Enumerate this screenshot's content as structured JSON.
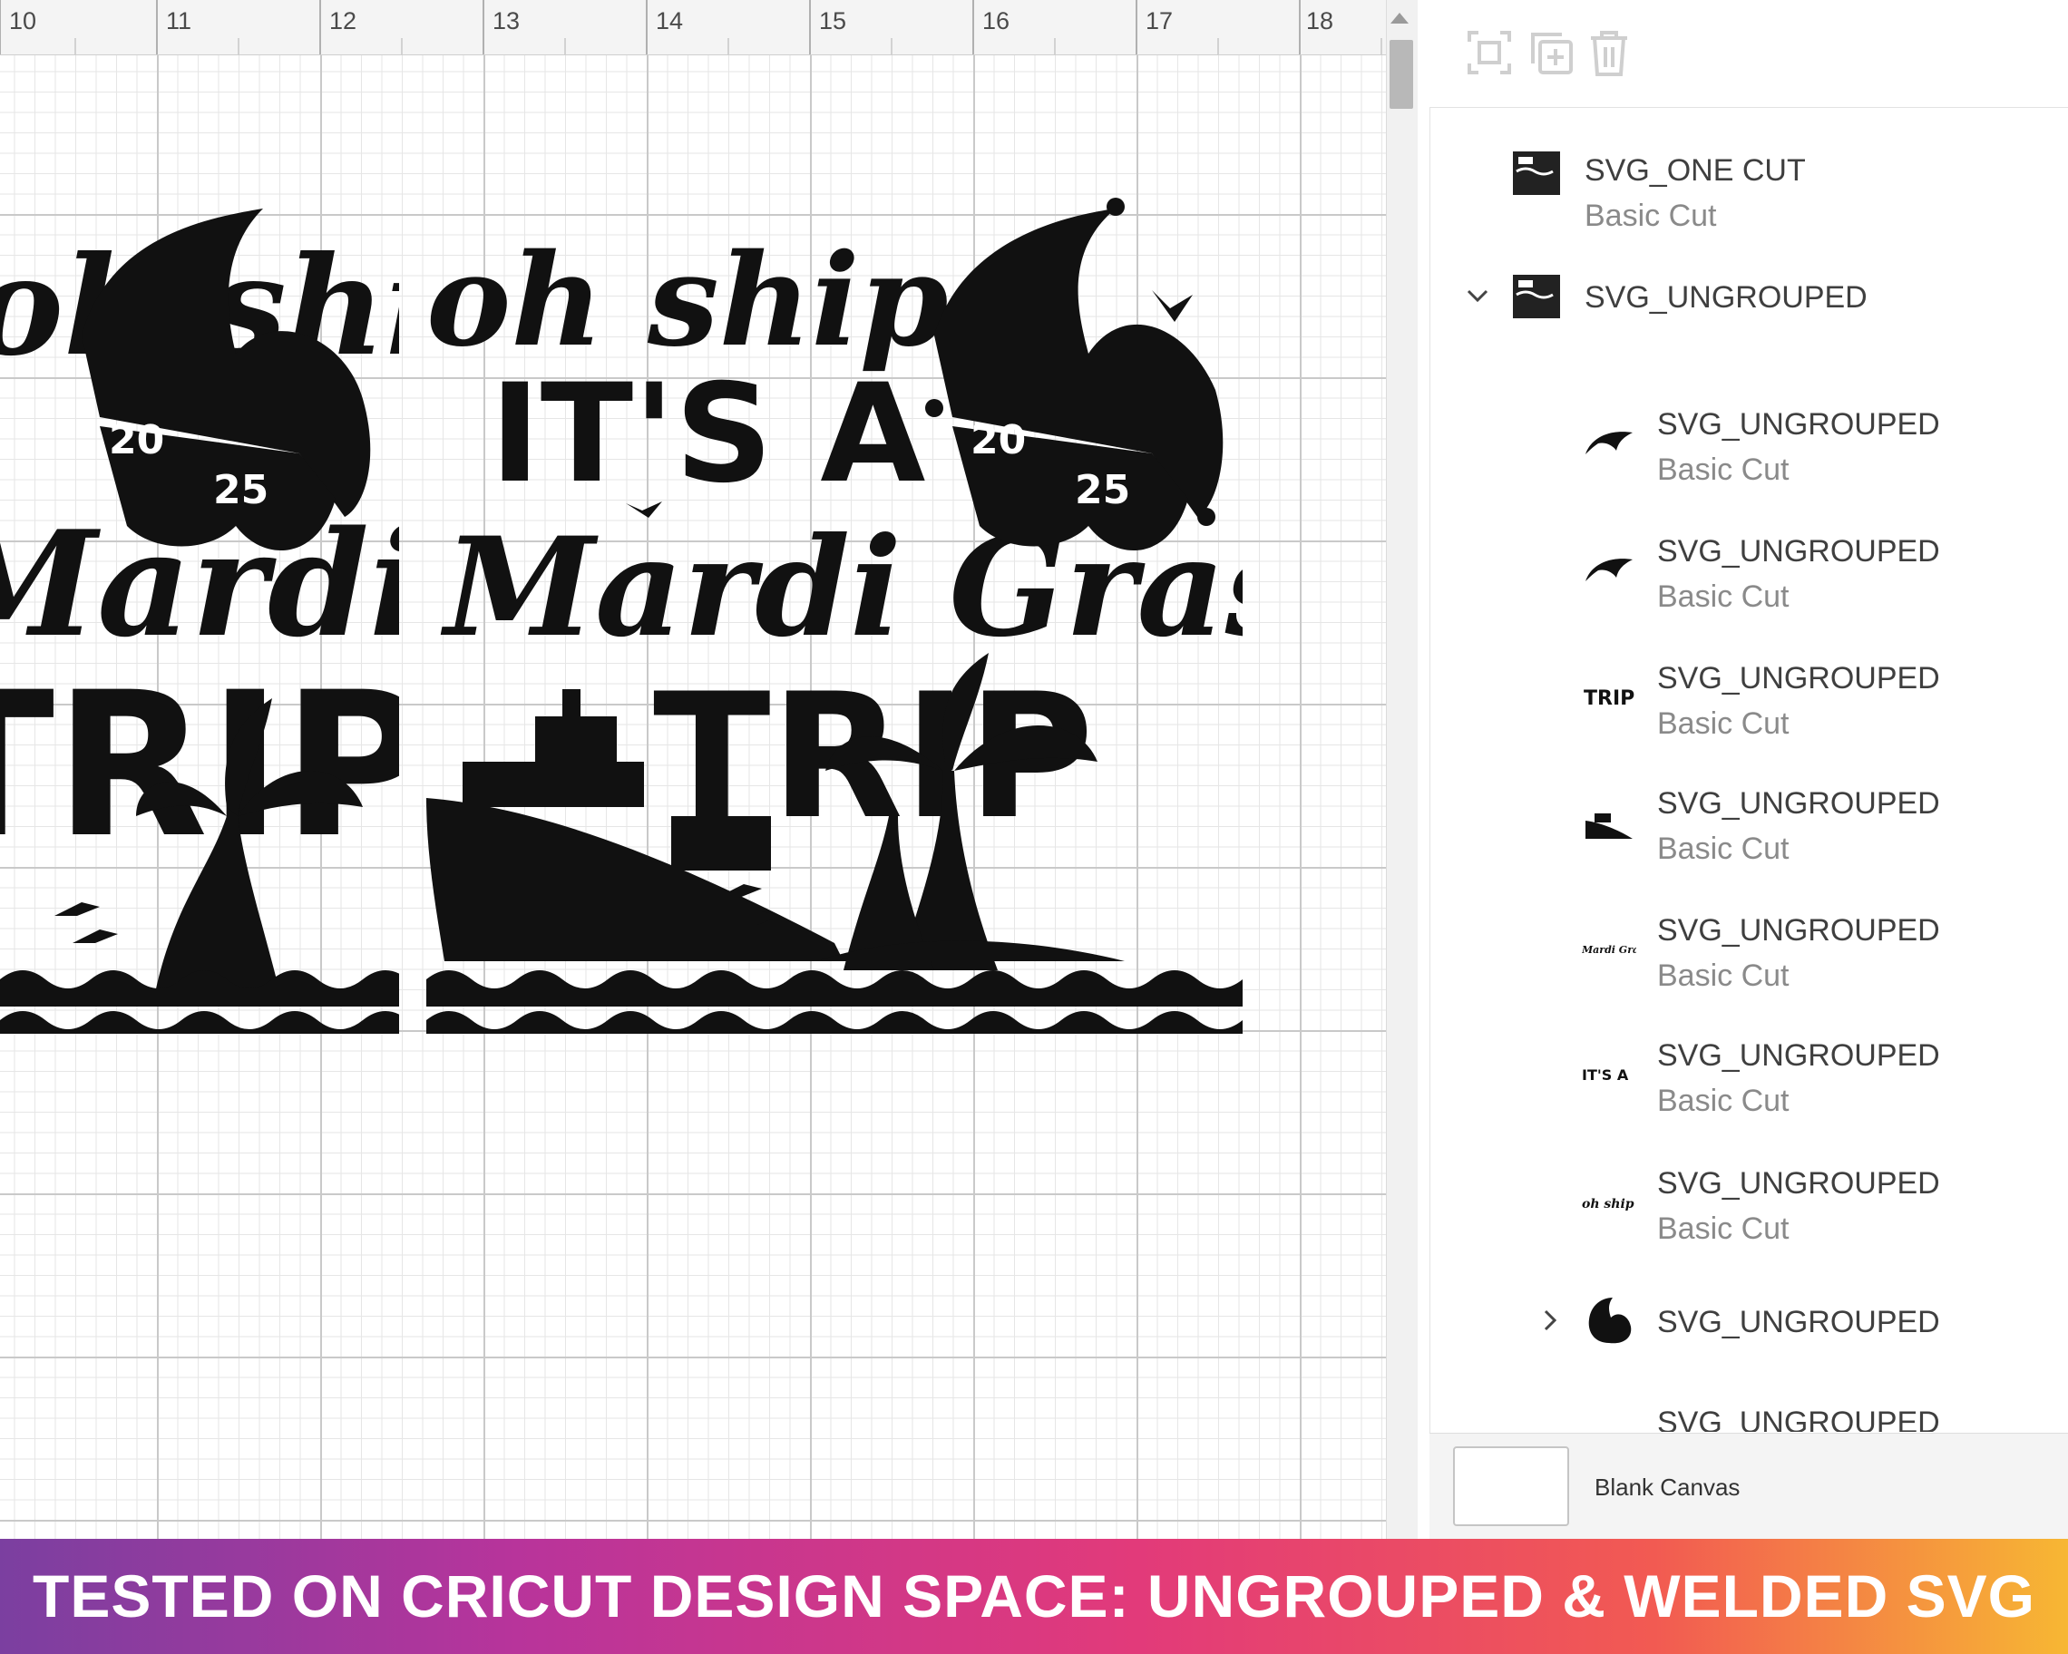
{
  "ruler": {
    "labels": [
      "10",
      "11",
      "12",
      "13",
      "14",
      "15",
      "16",
      "17",
      "18"
    ]
  },
  "artwork": {
    "line1": "oh ship",
    "line2": "IT'S A",
    "line3": "Mardi Gras",
    "line4": "TRIP",
    "mask_left": "20",
    "mask_right": "25"
  },
  "toolbar": {
    "group_icon": "group-icon",
    "duplicate_icon": "duplicate-icon",
    "delete_icon": "trash-icon"
  },
  "layers": [
    {
      "name": "SVG_ONE CUT",
      "op": "Basic Cut",
      "icon": "design-thumbnail-icon"
    },
    {
      "name": "SVG_UNGROUPED",
      "op": "",
      "icon": "design-thumbnail-icon",
      "expanded": true
    },
    {
      "name": "SVG_UNGROUPED",
      "op": "Basic Cut",
      "icon": "dolphin-icon"
    },
    {
      "name": "SVG_UNGROUPED",
      "op": "Basic Cut",
      "icon": "dolphin-icon"
    },
    {
      "name": "SVG_UNGROUPED",
      "op": "Basic Cut",
      "icon": "trip-text-icon"
    },
    {
      "name": "SVG_UNGROUPED",
      "op": "Basic Cut",
      "icon": "ship-icon"
    },
    {
      "name": "SVG_UNGROUPED",
      "op": "Basic Cut",
      "icon": "mardi-gras-text-icon"
    },
    {
      "name": "SVG_UNGROUPED",
      "op": "Basic Cut",
      "icon": "its-a-text-icon"
    },
    {
      "name": "SVG_UNGROUPED",
      "op": "Basic Cut",
      "icon": "oh-ship-text-icon"
    },
    {
      "name": "SVG_UNGROUPED",
      "op": "",
      "icon": "jester-hat-icon",
      "expanded": false
    },
    {
      "name": "SVG_UNGROUPED",
      "op": "",
      "icon": ""
    }
  ],
  "thumb_text": {
    "trip": "TRIP",
    "its_a": "IT'S A",
    "mardi": "Mardi Gras",
    "oh": "oh ship"
  },
  "canvas_bar": {
    "label": "Blank Canvas"
  },
  "banner": {
    "text": "TESTED ON CRICUT DESIGN SPACE: UNGROUPED & WELDED SVG"
  }
}
